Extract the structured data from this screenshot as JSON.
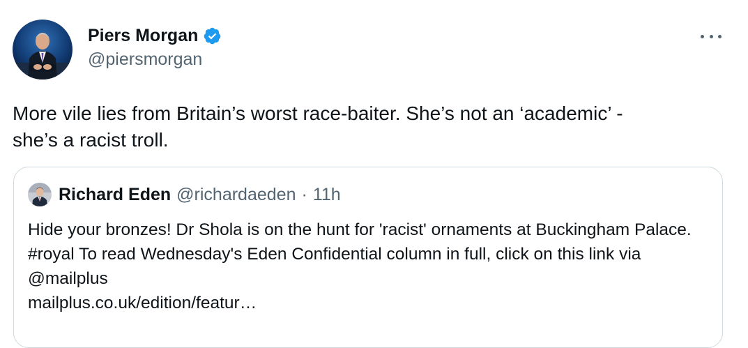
{
  "author": {
    "name": "Piers Morgan",
    "handle": "@piersmorgan",
    "avatar_icon": "person-avatar-icon",
    "verified_icon": "verified-badge-icon",
    "verified_color": "#1d9bf0"
  },
  "menu": {
    "icon": "more-options-icon"
  },
  "tweet": {
    "text": "More vile lies from Britain’s worst race-baiter. She’s not an ‘academic’ -\nshe’s a racist troll."
  },
  "quote": {
    "author_name": "Richard Eden",
    "author_handle": "@richardaeden",
    "separator": "·",
    "time": "11h",
    "text_main": "Hide your bronzes! Dr Shola is on the hunt for 'racist' ornaments at Buckingham Palace. #royal To read Wednesday's Eden Confidential column in full, click on this link via @mailplus",
    "link": "mailplus.co.uk/edition/featur…"
  },
  "colors": {
    "text_primary": "#0f1419",
    "text_secondary": "#536471",
    "border": "#cfd9de",
    "accent": "#1d9bf0"
  }
}
